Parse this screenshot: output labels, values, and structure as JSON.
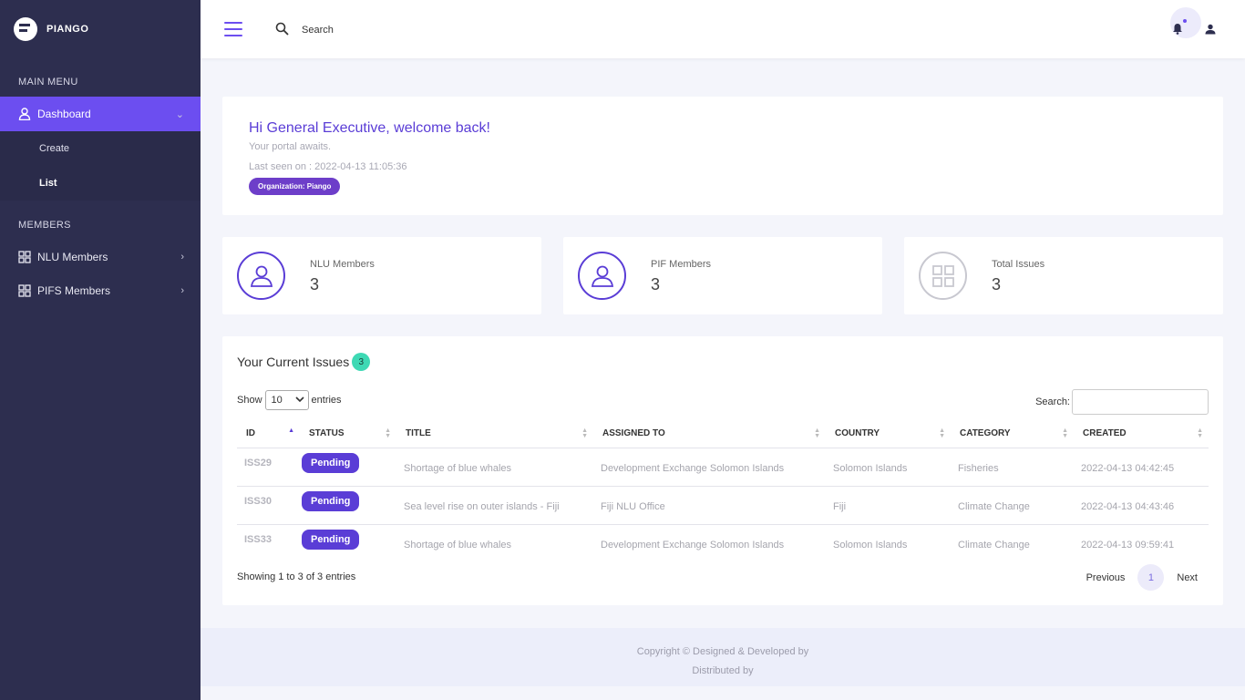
{
  "brand": {
    "name": "PIANGO"
  },
  "sidebar": {
    "main_menu_heading": "MAIN MENU",
    "dashboard": {
      "label": "Dashboard",
      "sub": [
        "Create",
        "List"
      ]
    },
    "members_heading": "MEMBERS",
    "items": [
      {
        "label": "NLU Members"
      },
      {
        "label": "PIFS Members"
      }
    ]
  },
  "topbar": {
    "search_placeholder": "Search"
  },
  "welcome": {
    "title": "Hi General Executive, welcome back!",
    "subtitle": "Your portal awaits.",
    "last_seen": "Last seen on : 2022-04-13 11:05:36",
    "org_badge": "Organization: Piango"
  },
  "stats": [
    {
      "label": "NLU Members",
      "value": "3"
    },
    {
      "label": "PIF Members",
      "value": "3"
    },
    {
      "label": "Total Issues",
      "value": "3"
    }
  ],
  "issues": {
    "title": "Your Current Issues",
    "count": "3",
    "show_label": "Show",
    "show_value": "10",
    "entries_label": "entries",
    "search_label": "Search:",
    "columns": [
      "ID",
      "STATUS",
      "TITLE",
      "ASSIGNED TO",
      "COUNTRY",
      "CATEGORY",
      "CREATED"
    ],
    "rows": [
      {
        "id": "ISS29",
        "status": "Pending",
        "title": "Shortage of blue whales",
        "assigned": "Development Exchange Solomon Islands",
        "country": "Solomon Islands",
        "category": "Fisheries",
        "created": "2022-04-13 04:42:45"
      },
      {
        "id": "ISS30",
        "status": "Pending",
        "title": "Sea level rise on outer islands - Fiji",
        "assigned": "Fiji NLU Office",
        "country": "Fiji",
        "category": "Climate Change",
        "created": "2022-04-13 04:43:46"
      },
      {
        "id": "ISS33",
        "status": "Pending",
        "title": "Shortage of blue whales",
        "assigned": "Development Exchange Solomon Islands",
        "country": "Solomon Islands",
        "category": "Climate Change",
        "created": "2022-04-13 09:59:41"
      }
    ],
    "showing": "Showing 1 to 3 of 3 entries",
    "pager": {
      "previous": "Previous",
      "page": "1",
      "next": "Next"
    }
  },
  "footer": {
    "line1": "Copyright © Designed & Developed by",
    "line2": "Distributed by"
  },
  "colors": {
    "sidebar": "#2d2e4f",
    "accent": "#6c4ef0",
    "badge_count": "#3ed9b4"
  }
}
